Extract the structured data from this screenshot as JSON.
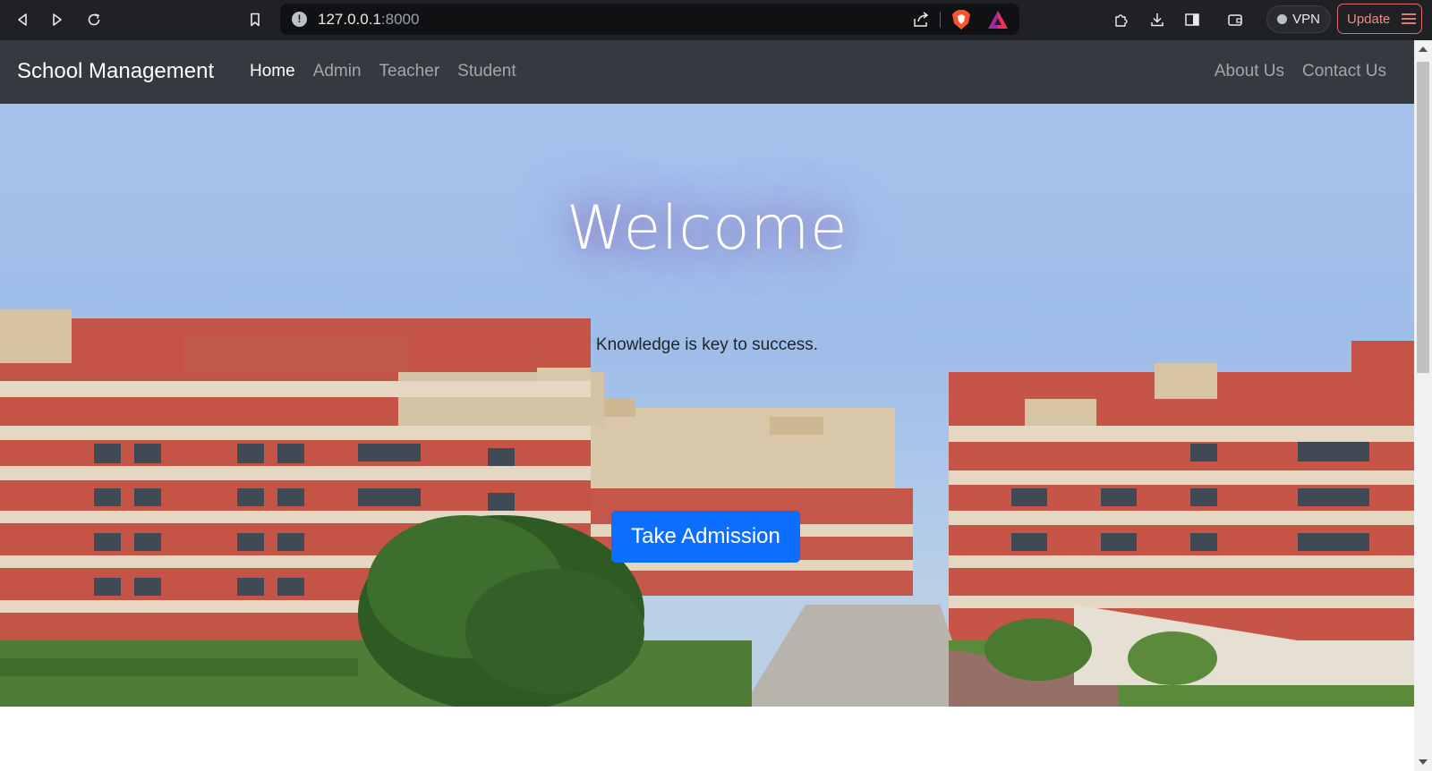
{
  "browser": {
    "url_host": "127.0.0.1",
    "url_port": ":8000",
    "vpn_label": "VPN",
    "update_label": "Update",
    "icons": [
      "back-icon",
      "forward-icon",
      "reload-icon",
      "bookmark-icon",
      "site-info-icon",
      "share-icon",
      "brave-shields-icon",
      "brave-rewards-icon",
      "extensions-icon",
      "downloads-icon",
      "sidebar-icon",
      "wallet-icon",
      "menu-icon"
    ]
  },
  "nav": {
    "brand": "School Management",
    "left_links": [
      {
        "label": "Home",
        "active": true
      },
      {
        "label": "Admin",
        "active": false
      },
      {
        "label": "Teacher",
        "active": false
      },
      {
        "label": "Student",
        "active": false
      }
    ],
    "right_links": [
      {
        "label": "About Us"
      },
      {
        "label": "Contact Us"
      }
    ]
  },
  "hero": {
    "title": "Welcome",
    "tagline": "Knowledge is key to success.",
    "cta_label": "Take Admission"
  },
  "colors": {
    "chrome_bg": "#202124",
    "navbar_bg": "#343a40",
    "primary_button": "#0d6efd",
    "welcome_glow": "#7a5fb0"
  }
}
